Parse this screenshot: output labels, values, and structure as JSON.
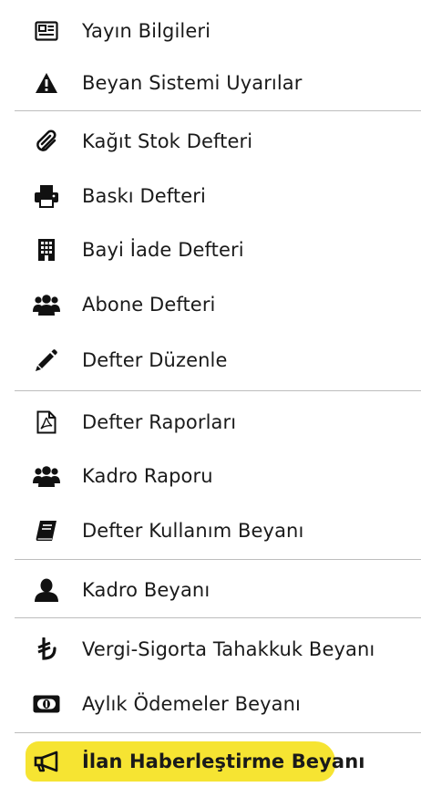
{
  "menu": {
    "items": [
      {
        "label": "Yayın Bilgileri",
        "icon": "newspaper-icon"
      },
      {
        "label": "Beyan Sistemi Uyarılar",
        "icon": "warning-icon"
      },
      {
        "label": "Kağıt Stok Defteri",
        "icon": "paperclip-icon"
      },
      {
        "label": "Baskı Defteri",
        "icon": "printer-icon"
      },
      {
        "label": "Bayi İade Defteri",
        "icon": "building-icon"
      },
      {
        "label": "Abone Defteri",
        "icon": "users-icon"
      },
      {
        "label": "Defter Düzenle",
        "icon": "pencil-icon"
      },
      {
        "label": "Defter Raporları",
        "icon": "pdf-file-icon"
      },
      {
        "label": "Kadro Raporu",
        "icon": "users-icon"
      },
      {
        "label": "Defter Kullanım Beyanı",
        "icon": "book-icon"
      },
      {
        "label": "Kadro Beyanı",
        "icon": "user-icon"
      },
      {
        "label": "Vergi-Sigorta Tahakkuk Beyanı",
        "icon": "lira-icon"
      },
      {
        "label": "Aylık Ödemeler Beyanı",
        "icon": "money-icon"
      },
      {
        "label": "İlan Haberleştirme Beyanı",
        "icon": "bullhorn-icon"
      }
    ],
    "active_item": "İlan Haberleştirme Beyanı",
    "highlight_color": "#f6e432"
  }
}
